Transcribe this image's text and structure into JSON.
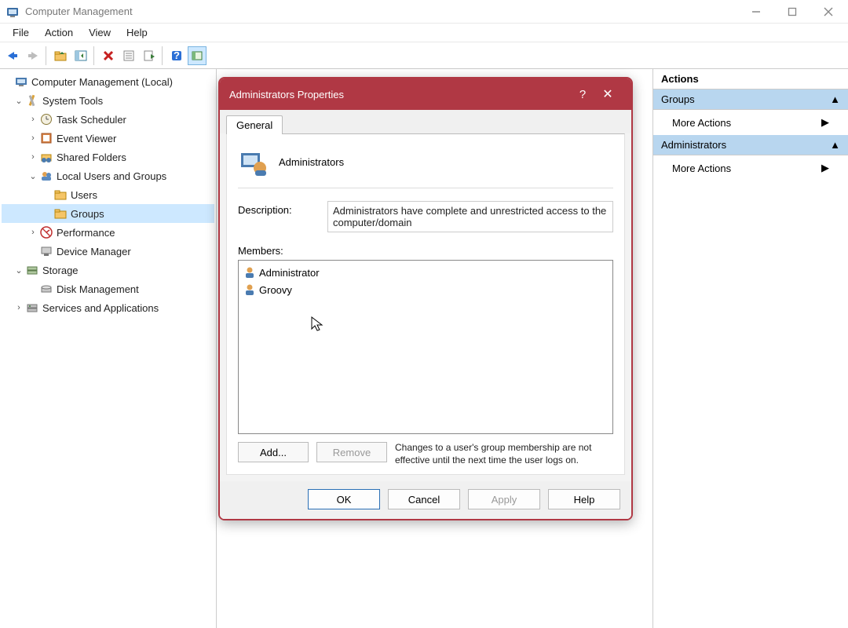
{
  "window": {
    "title": "Computer Management"
  },
  "menu": {
    "file": "File",
    "action": "Action",
    "view": "View",
    "help": "Help"
  },
  "tree": {
    "root": "Computer Management (Local)",
    "system_tools": "System Tools",
    "task_scheduler": "Task Scheduler",
    "event_viewer": "Event Viewer",
    "shared_folders": "Shared Folders",
    "local_users_groups": "Local Users and Groups",
    "users": "Users",
    "groups": "Groups",
    "performance": "Performance",
    "device_manager": "Device Manager",
    "storage": "Storage",
    "disk_management": "Disk Management",
    "services_apps": "Services and Applications"
  },
  "actions": {
    "header": "Actions",
    "section1": "Groups",
    "more1": "More Actions",
    "section2": "Administrators",
    "more2": "More Actions"
  },
  "dialog": {
    "title": "Administrators Properties",
    "tab_general": "General",
    "group_name": "Administrators",
    "description_label": "Description:",
    "description_value": "Administrators have complete and unrestricted access to the computer/domain",
    "members_label": "Members:",
    "members": [
      "Administrator",
      "Groovy"
    ],
    "add": "Add...",
    "remove": "Remove",
    "note": "Changes to a user's group membership are not effective until the next time the user logs on.",
    "ok": "OK",
    "cancel": "Cancel",
    "apply": "Apply",
    "help": "Help"
  }
}
